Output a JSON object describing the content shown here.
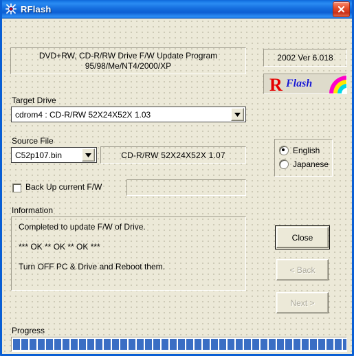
{
  "window": {
    "title": "RFlash",
    "icon": "rflash-star-icon",
    "close_label": "Close window",
    "titlebar_color": "#1a7ae8",
    "close_button_color": "#e8502c"
  },
  "header": {
    "line1": "DVD+RW, CD-R/RW Drive F/W Update Program",
    "line2": "95/98/Me/NT4/2000/XP"
  },
  "version": {
    "text": "2002  Ver 6.018"
  },
  "logo": {
    "letter": "R",
    "word": "Flash",
    "letter_color": "#e60000",
    "word_color": "#1414cc",
    "rainbow": [
      "#ff00c8",
      "#ffe800",
      "#00d8e8"
    ]
  },
  "target_drive": {
    "label": "Target Drive",
    "value": "cdrom4 :  CD-R/RW 52X24X52X       1.03",
    "options": [
      "cdrom4 :  CD-R/RW 52X24X52X       1.03"
    ]
  },
  "source_file": {
    "label": "Source File",
    "value": "C52p107.bin",
    "options": [
      "C52p107.bin"
    ],
    "info": "CD-R/RW  52X24X52X        1.07"
  },
  "backup": {
    "label": "Back Up current F/W",
    "checked": false,
    "path_value": ""
  },
  "information": {
    "label": "Information",
    "lines": [
      "Completed to update F/W of Drive.",
      "*** OK ** OK ** OK ***",
      "Turn OFF PC & Drive and Reboot them."
    ]
  },
  "language": {
    "options": [
      {
        "label": "English",
        "selected": true
      },
      {
        "label": "Japanese",
        "selected": false
      }
    ]
  },
  "buttons": {
    "close": {
      "label": "Close",
      "enabled": true,
      "default": true
    },
    "back": {
      "label": "< Back",
      "enabled": false
    },
    "next": {
      "label": "Next >",
      "enabled": false
    }
  },
  "progress": {
    "label": "Progress",
    "percent": 100,
    "segments": 41,
    "bar_color": "#3a6ec4"
  }
}
